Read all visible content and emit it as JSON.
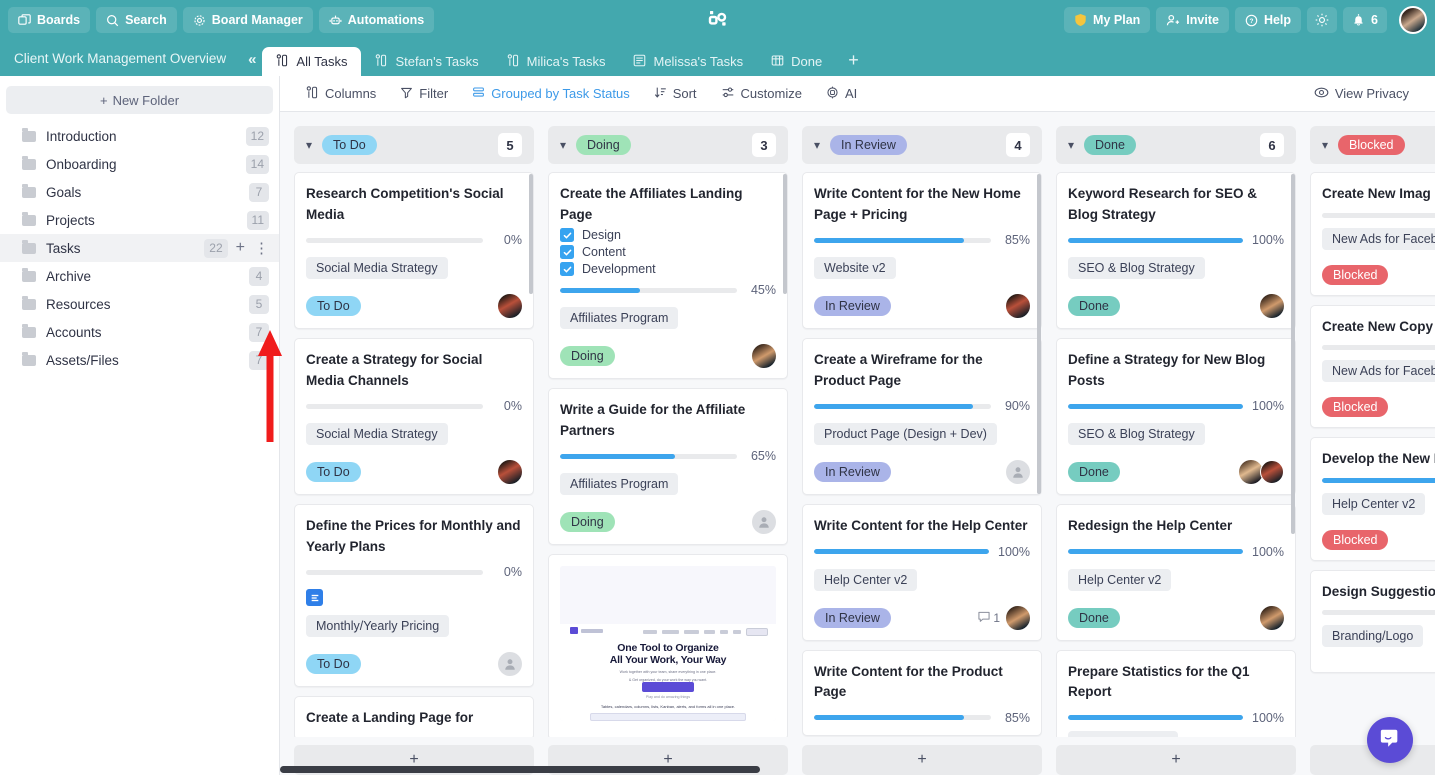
{
  "topbar": {
    "left_buttons": [
      {
        "label": "Boards",
        "icon": "boards-icon"
      },
      {
        "label": "Search",
        "icon": "search-icon"
      },
      {
        "label": "Board Manager",
        "icon": "gear-icon"
      },
      {
        "label": "Automations",
        "icon": "robot-icon"
      }
    ],
    "logo_name": "app-logo",
    "right_buttons": [
      {
        "label": "My Plan",
        "icon": "shield-icon"
      },
      {
        "label": "Invite",
        "icon": "user-plus-icon"
      },
      {
        "label": "Help",
        "icon": "question-circle-icon"
      }
    ],
    "theme_icon": "sun-icon",
    "bell_icon": "bell-icon",
    "notification_count": "6",
    "avatar_name": "user-avatar"
  },
  "subbar": {
    "board_title": "Client Work Management Overview",
    "collapse_label": "«",
    "tabs": [
      {
        "label": "All Tasks",
        "icon": "kanban-icon",
        "active": true
      },
      {
        "label": "Stefan's Tasks",
        "icon": "kanban-icon",
        "active": false
      },
      {
        "label": "Milica's Tasks",
        "icon": "kanban-icon",
        "active": false
      },
      {
        "label": "Melissa's Tasks",
        "icon": "list-icon",
        "active": false
      },
      {
        "label": "Done",
        "icon": "table-icon",
        "active": false
      }
    ],
    "add_tab_label": "+"
  },
  "sidebar": {
    "new_folder_label": "New Folder",
    "items": [
      {
        "label": "Introduction",
        "count": "12",
        "selected": false
      },
      {
        "label": "Onboarding",
        "count": "14",
        "selected": false
      },
      {
        "label": "Goals",
        "count": "7",
        "selected": false
      },
      {
        "label": "Projects",
        "count": "11",
        "selected": false
      },
      {
        "label": "Tasks",
        "count": "22",
        "selected": true
      },
      {
        "label": "Archive",
        "count": "4",
        "selected": false
      },
      {
        "label": "Resources",
        "count": "5",
        "selected": false
      },
      {
        "label": "Accounts",
        "count": "7",
        "selected": false
      },
      {
        "label": "Assets/Files",
        "count": "7",
        "selected": false
      }
    ]
  },
  "toolbar": {
    "items": [
      {
        "label": "Columns",
        "icon": "columns-icon",
        "highlighted": false
      },
      {
        "label": "Filter",
        "icon": "funnel-icon",
        "highlighted": false
      },
      {
        "label": "Grouped by Task Status",
        "icon": "group-icon",
        "highlighted": true
      },
      {
        "label": "Sort",
        "icon": "sort-icon",
        "highlighted": false
      },
      {
        "label": "Customize",
        "icon": "sliders-icon",
        "highlighted": false
      },
      {
        "label": "AI",
        "icon": "ai-icon",
        "highlighted": false
      }
    ],
    "view_privacy_label": "View Privacy",
    "view_privacy_icon": "eye-icon"
  },
  "colors": {
    "brand_teal": "#43a8ae",
    "accent_blue": "#3da5ed",
    "todo": "#8fd6f5",
    "doing": "#9fe3b7",
    "in_review": "#aab4e8",
    "done": "#76ccc0",
    "blocked": "#e8656b"
  },
  "board": {
    "add_card_label": "+",
    "columns": [
      {
        "status": "To Do",
        "color": "#8fd6f5",
        "count": "5",
        "cards": [
          {
            "title": "Research Competition's Social Media",
            "progress": 0,
            "progress_label": "0%",
            "tag": "Social Media Strategy",
            "status": "To Do",
            "avatar": "p1"
          },
          {
            "title": "Create a Strategy for Social Media Channels",
            "progress": 0,
            "progress_label": "0%",
            "tag": "Social Media Strategy",
            "status": "To Do",
            "avatar": "p1"
          },
          {
            "title": "Define the Prices for Monthly and Yearly Plans",
            "progress": 0,
            "progress_label": "0%",
            "has_doc": true,
            "tag": "Monthly/Yearly Pricing",
            "status": "To Do",
            "avatar": "empty"
          },
          {
            "title": "Create a Landing Page for",
            "partial": true
          }
        ]
      },
      {
        "status": "Doing",
        "color": "#9fe3b7",
        "count": "3",
        "cards": [
          {
            "title": "Create the Affiliates Landing Page",
            "checklist": [
              "Design",
              "Content",
              "Development"
            ],
            "progress": 45,
            "progress_label": "45%",
            "tag": "Affiliates Program",
            "status": "Doing",
            "avatar": "p2"
          },
          {
            "title": "Write a Guide for the Affiliate Partners",
            "progress": 65,
            "progress_label": "65%",
            "tag": "Affiliates Program",
            "status": "Doing",
            "avatar": "empty"
          },
          {
            "title": "",
            "image": true,
            "image_headline_1": "One Tool to Organize",
            "image_headline_2": "All Your Work, Your Way",
            "partial": true
          }
        ]
      },
      {
        "status": "In Review",
        "color": "#aab4e8",
        "count": "4",
        "cards": [
          {
            "title": "Write Content for the New Home Page + Pricing",
            "progress": 85,
            "progress_label": "85%",
            "tag": "Website v2",
            "status": "In Review",
            "avatar": "p1"
          },
          {
            "title": "Create a Wireframe for the Product Page",
            "progress": 90,
            "progress_label": "90%",
            "tag": "Product Page (Design + Dev)",
            "status": "In Review",
            "avatar": "empty"
          },
          {
            "title": "Write Content for the Help Center",
            "progress": 100,
            "progress_label": "100%",
            "tag": "Help Center v2",
            "status": "In Review",
            "comments": "1",
            "avatar": "p2"
          },
          {
            "title": "Write Content for the Product Page",
            "progress": 85,
            "progress_label": "85%",
            "partial": true
          }
        ]
      },
      {
        "status": "Done",
        "color": "#76ccc0",
        "count": "6",
        "cards": [
          {
            "title": "Keyword Research for SEO & Blog Strategy",
            "progress": 100,
            "progress_label": "100%",
            "tag": "SEO & Blog Strategy",
            "status": "Done",
            "avatar": "p2"
          },
          {
            "title": "Define a Strategy for New Blog Posts",
            "progress": 100,
            "progress_label": "100%",
            "tag": "SEO & Blog Strategy",
            "status": "Done",
            "avatar": "stack"
          },
          {
            "title": "Redesign the Help Center",
            "progress": 100,
            "progress_label": "100%",
            "tag": "Help Center v2",
            "status": "Done",
            "avatar": "p2"
          },
          {
            "title": "Prepare Statistics for the Q1 Report",
            "progress": 100,
            "progress_label": "100%",
            "partial": true
          }
        ]
      },
      {
        "status": "Blocked",
        "color": "#e8656b",
        "count": "",
        "cards": [
          {
            "title": "Create New Imag",
            "progress": 0,
            "tag": "New Ads for Faceb",
            "status": "Blocked"
          },
          {
            "title": "Create New Copy",
            "progress": 0,
            "tag": "New Ads for Faceb",
            "status": "Blocked"
          },
          {
            "title": "Develop the New Platform",
            "progress": 100,
            "tag": "Help Center v2",
            "status": "Blocked"
          },
          {
            "title": "Design Suggestio Logo",
            "progress": 0,
            "tag": "Branding/Logo",
            "partial": true
          }
        ]
      }
    ]
  },
  "chat": {
    "icon": "chat-bubble-icon"
  }
}
